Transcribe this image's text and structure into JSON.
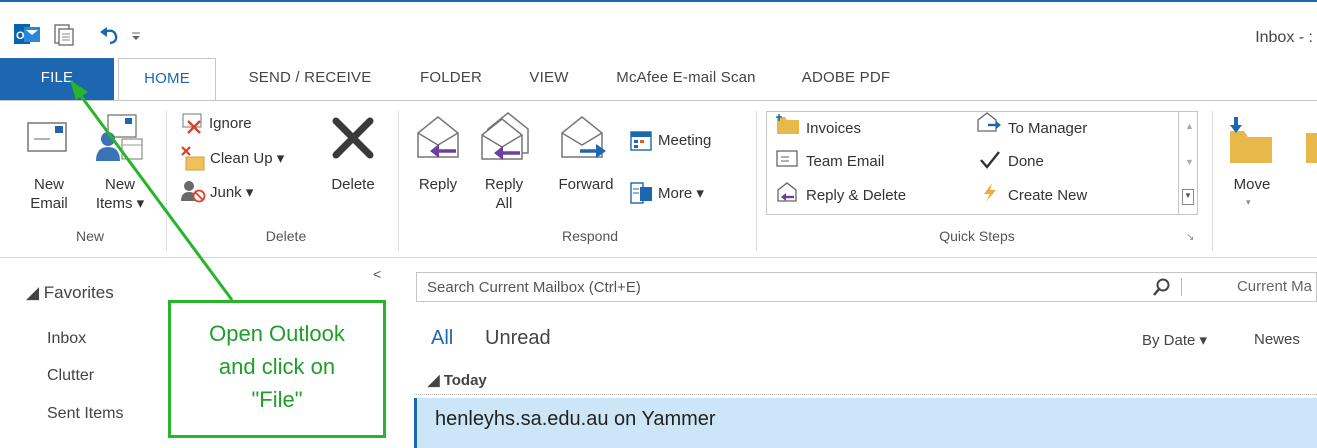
{
  "window": {
    "title": "Inbox - :"
  },
  "quick_access": [
    {
      "icon": "outlook-logo-icon"
    },
    {
      "icon": "send-receive-all-icon"
    },
    {
      "icon": "undo-icon"
    },
    {
      "icon": "customize-qat-icon"
    }
  ],
  "tabs": [
    {
      "label": "FILE"
    },
    {
      "label": "HOME"
    },
    {
      "label": "SEND / RECEIVE"
    },
    {
      "label": "FOLDER"
    },
    {
      "label": "VIEW"
    },
    {
      "label": "McAfee E-mail Scan"
    },
    {
      "label": "ADOBE PDF"
    }
  ],
  "ribbon": {
    "new": {
      "group": "New",
      "new_email": [
        "New",
        "Email"
      ],
      "new_items": [
        "New",
        "Items ▾"
      ]
    },
    "delete": {
      "group": "Delete",
      "ignore": "Ignore",
      "clean_up": "Clean Up ▾",
      "junk": "Junk ▾",
      "delete": "Delete"
    },
    "respond": {
      "group": "Respond",
      "reply": "Reply",
      "reply_all": [
        "Reply",
        "All"
      ],
      "forward": "Forward",
      "meeting": "Meeting",
      "more": "More ▾"
    },
    "quick_steps": {
      "group": "Quick Steps",
      "items": [
        "Invoices",
        "To Manager",
        "Team Email",
        "Done",
        "Reply & Delete",
        "Create New"
      ]
    },
    "move": {
      "move": "Move"
    }
  },
  "left_pane": {
    "favorites": "◢ Favorites",
    "items": [
      "Inbox",
      "Clutter",
      "Sent Items"
    ],
    "collapse": "<"
  },
  "mail_list": {
    "search_placeholder": "Search Current Mailbox (Ctrl+E)",
    "scope": "Current Ma",
    "filters": [
      "All",
      "Unread"
    ],
    "sort_by": "By Date ▾",
    "sort_order": "Newes",
    "group_header": "◢ Today",
    "first_item_sender": "henleyhs.sa.edu.au on Yammer"
  },
  "annotation": {
    "lines": [
      "Open Outlook",
      "and click on",
      "\"File\""
    ],
    "color": "#27b52c"
  },
  "colors": {
    "accent": "#1d66b0",
    "selected_item": "#cde6f7",
    "annotation": "#27b52c"
  }
}
